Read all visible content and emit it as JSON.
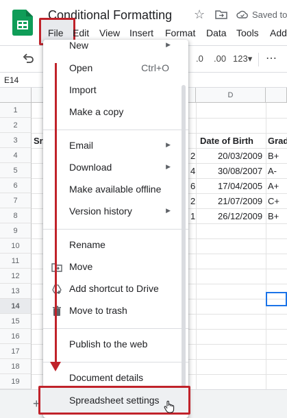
{
  "header": {
    "title": "Conditional Formatting",
    "saved_status": "Saved to D"
  },
  "menubar": [
    "File",
    "Edit",
    "View",
    "Insert",
    "Format",
    "Data",
    "Tools",
    "Add"
  ],
  "toolbar": {
    "dec_decrease": ".0",
    "dec_increase": ".00",
    "format": "123▾",
    "more": "⋯"
  },
  "formula_bar": {
    "cell_ref": "E14"
  },
  "sheet": {
    "col_d_header": "D",
    "row_numbers": [
      "1",
      "2",
      "3",
      "4",
      "5",
      "6",
      "7",
      "8",
      "9",
      "10",
      "11",
      "12",
      "13",
      "14",
      "15",
      "16",
      "17",
      "18",
      "19"
    ],
    "header_row": {
      "a_partial": "Sr.",
      "dob": "Date of Birth",
      "grade": "Grad"
    },
    "rows": [
      {
        "c": "2",
        "dob": "20/03/2009",
        "grade": "B+"
      },
      {
        "c": "4",
        "dob": "30/08/2007",
        "grade": "A-"
      },
      {
        "c": "6",
        "dob": "17/04/2005",
        "grade": "A+"
      },
      {
        "c": "2",
        "dob": "21/07/2009",
        "grade": "C+"
      },
      {
        "c": "1",
        "dob": "26/12/2009",
        "grade": "B+"
      }
    ]
  },
  "file_menu": {
    "new": "New",
    "open": "Open",
    "open_shortcut": "Ctrl+O",
    "import": "Import",
    "make_copy": "Make a copy",
    "email": "Email",
    "download": "Download",
    "make_offline": "Make available offline",
    "version_history": "Version history",
    "rename": "Rename",
    "move": "Move",
    "add_shortcut": "Add shortcut to Drive",
    "move_trash": "Move to trash",
    "publish": "Publish to the web",
    "document_details": "Document details",
    "spreadsheet_settings": "Spreadsheet settings"
  },
  "colors": {
    "accent": "#1a73e8",
    "highlight": "#c0222a",
    "sheets_green": "#0f9d58"
  }
}
